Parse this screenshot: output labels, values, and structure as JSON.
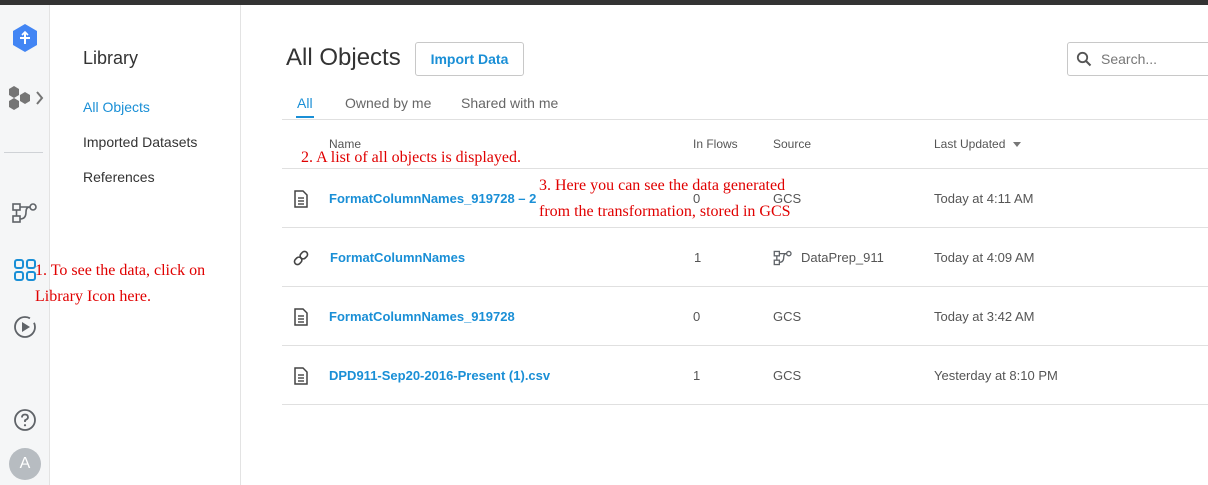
{
  "library": {
    "title": "Library",
    "items": [
      {
        "label": "All Objects"
      },
      {
        "label": "Imported Datasets"
      },
      {
        "label": "References"
      }
    ]
  },
  "header": {
    "title": "All Objects",
    "import_label": "Import Data",
    "search_placeholder": "Search..."
  },
  "tabs": [
    {
      "label": "All"
    },
    {
      "label": "Owned by me"
    },
    {
      "label": "Shared with me"
    }
  ],
  "columns": {
    "name": "Name",
    "in_flows": "In Flows",
    "source": "Source",
    "last_updated": "Last Updated"
  },
  "rows": [
    {
      "icon": "dataset-file-icon",
      "name": "FormatColumnNames_919728 – 2",
      "in_flows": "0",
      "source": "GCS",
      "last_updated": "Today at 4:11 AM"
    },
    {
      "icon": "reference-link-icon",
      "name": "FormatColumnNames",
      "in_flows": "1",
      "source": "DataPrep_911",
      "source_icon": "flow-icon",
      "last_updated": "Today at 4:09 AM"
    },
    {
      "icon": "dataset-file-icon",
      "name": "FormatColumnNames_919728",
      "in_flows": "0",
      "source": "GCS",
      "last_updated": "Today at 3:42 AM"
    },
    {
      "icon": "dataset-file-icon",
      "name": "DPD911-Sep20-2016-Present (1).csv",
      "in_flows": "1",
      "source": "GCS",
      "last_updated": "Yesterday at 8:10 PM"
    }
  ],
  "user": {
    "avatar_initial": "A"
  },
  "annotations": {
    "step1": "1. To see the data, click on",
    "step1b": "Library Icon here.",
    "step2": "2. A list of all objects is displayed.",
    "step3": "3. Here you can see the data generated",
    "step3b": "from the transformation, stored in GCS"
  },
  "colors": {
    "accent": "#1a8fd6",
    "annotation": "#e00000",
    "logo": "#4285f4"
  }
}
